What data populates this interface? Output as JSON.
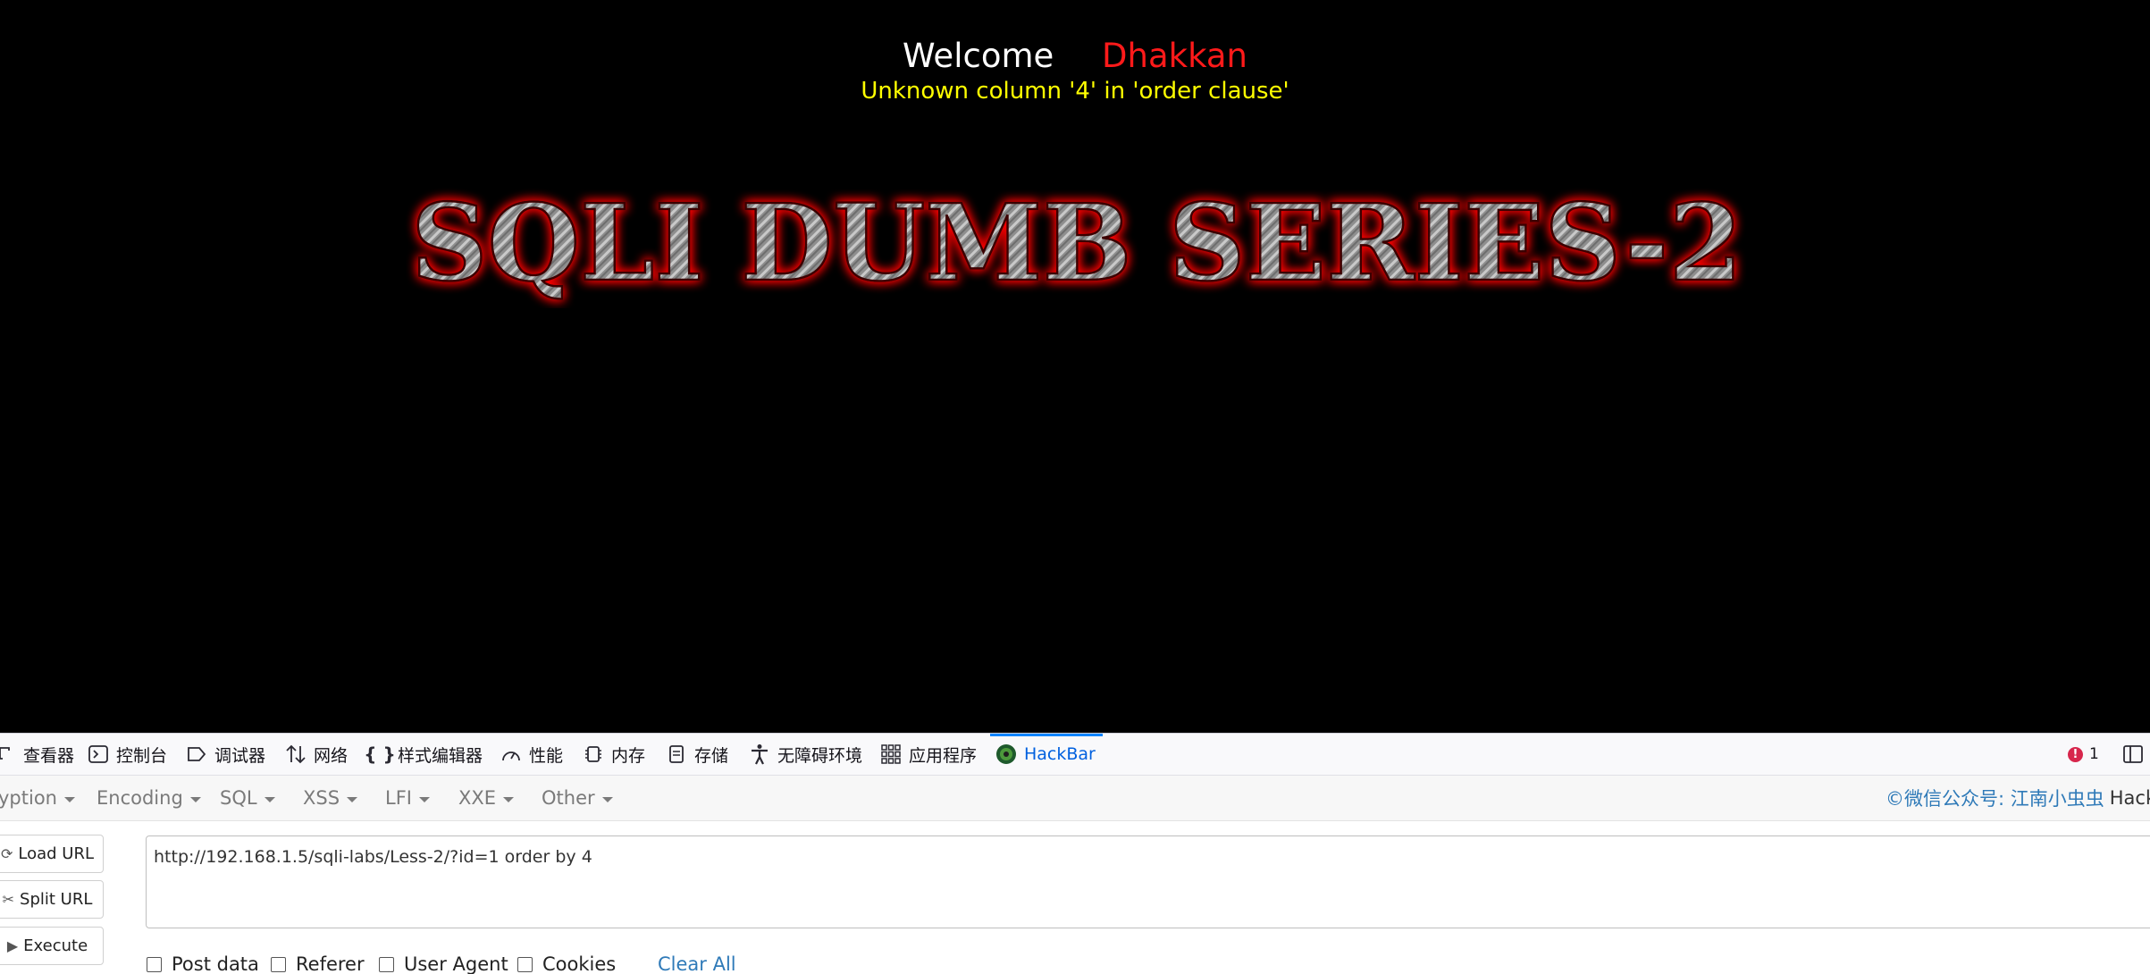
{
  "page": {
    "welcome": "Welcome",
    "username": "Dhakkan",
    "error_message": "Unknown column '4' in 'order clause'",
    "banner_text": "SQLI DUMB SERIES-2"
  },
  "devtools": {
    "tabs": [
      {
        "label": "查看器",
        "icon": "inspector-icon"
      },
      {
        "label": "控制台",
        "icon": "console-icon"
      },
      {
        "label": "调试器",
        "icon": "debugger-icon"
      },
      {
        "label": "网络",
        "icon": "network-icon"
      },
      {
        "label": "样式编辑器",
        "icon": "style-editor-icon"
      },
      {
        "label": "性能",
        "icon": "performance-icon"
      },
      {
        "label": "内存",
        "icon": "memory-icon"
      },
      {
        "label": "存储",
        "icon": "storage-icon"
      },
      {
        "label": "无障碍环境",
        "icon": "accessibility-icon"
      },
      {
        "label": "应用程序",
        "icon": "application-icon"
      },
      {
        "label": "HackBar",
        "icon": "hackbar-icon",
        "active": true
      }
    ],
    "error_count": "1"
  },
  "hackbar": {
    "menu": [
      "yption",
      "Encoding",
      "SQL",
      "XSS",
      "LFI",
      "XXE",
      "Other"
    ],
    "credit": "©微信公众号: 江南小虫虫",
    "credit_suffix": "Hackl",
    "buttons": {
      "load_url": "Load URL",
      "split_url": "Split URL",
      "execute": "Execute"
    },
    "url_value": "http://192.168.1.5/sqli-labs/Less-2/?id=1 order by 4",
    "options": {
      "post_data": "Post data",
      "referer": "Referer",
      "user_agent": "User Agent",
      "cookies": "Cookies",
      "clear_all": "Clear All"
    }
  },
  "colors": {
    "background": "#000000",
    "welcome": "#ffffff",
    "username": "#ff1a1a",
    "error": "#ffff00",
    "active_tab": "#0060df",
    "link": "#2f7ab8"
  }
}
